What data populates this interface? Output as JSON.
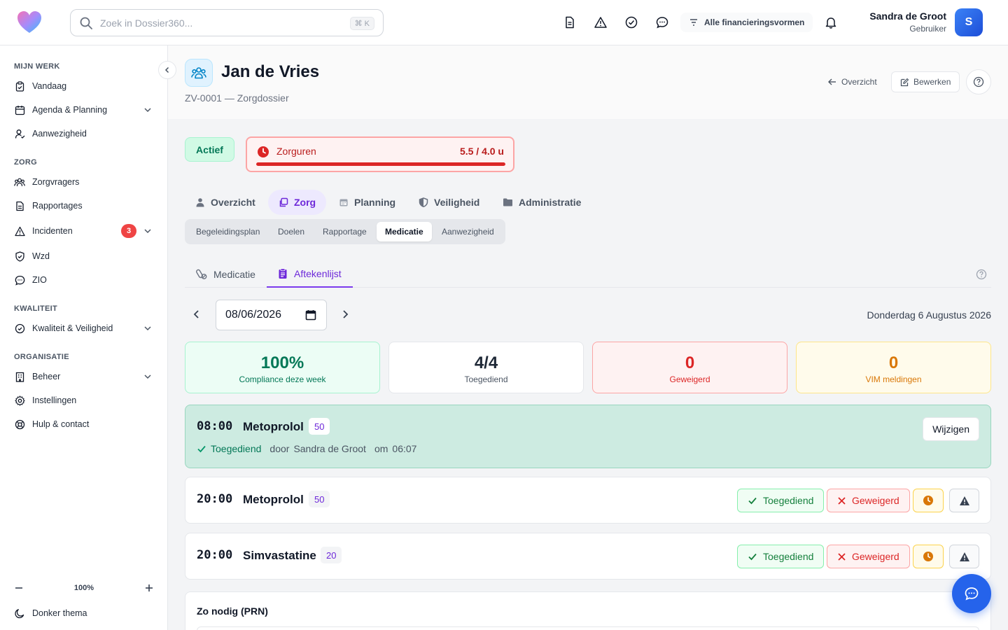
{
  "topbar": {
    "search_placeholder": "Zoek in Dossier360...",
    "search_shortcut": "⌘ K",
    "financing_filter": "Alle financieringsvormen",
    "user_name": "Sandra de Groot",
    "user_role": "Gebruiker",
    "avatar_initial": "S"
  },
  "sidebar": {
    "sections": {
      "mijn_werk": "MIJN WERK",
      "zorg": "ZORG",
      "kwaliteit": "KWALITEIT",
      "organisatie": "ORGANISATIE"
    },
    "items": {
      "vandaag": "Vandaag",
      "agenda": "Agenda & Planning",
      "aanwezigheid": "Aanwezigheid",
      "zorgvragers": "Zorgvragers",
      "rapportages": "Rapportages",
      "incidenten": "Incidenten",
      "incidenten_badge": "3",
      "wzd": "Wzd",
      "zio": "ZIO",
      "kwaliteit_veiligheid": "Kwaliteit & Veiligheid",
      "beheer": "Beheer",
      "instellingen": "Instellingen",
      "hulp": "Hulp & contact"
    },
    "zoom_level": "100%",
    "dark_theme": "Donker thema"
  },
  "header": {
    "title": "Jan de Vries",
    "subtitle": "ZV-0001 — Zorgdossier",
    "overview_link": "Overzicht",
    "edit_button": "Bewerken"
  },
  "status": {
    "label": "Actief",
    "zorguren_label": "Zorguren",
    "zorguren_value": "5.5 / 4.0 u",
    "zorguren_fill": 1.0
  },
  "main_tabs": [
    "Overzicht",
    "Zorg",
    "Planning",
    "Veiligheid",
    "Administratie"
  ],
  "sub_tabs": [
    "Begeleidingsplan",
    "Doelen",
    "Rapportage",
    "Medicatie",
    "Aanwezigheid"
  ],
  "inner_tabs": [
    "Medicatie",
    "Aftekenlijst"
  ],
  "date_picker": {
    "value": "08/06/2026",
    "long_label": "Donderdag 6 Augustus 2026"
  },
  "stats": [
    {
      "value": "100%",
      "caption": "Compliance deze week"
    },
    {
      "value": "4/4",
      "caption": "Toegediend"
    },
    {
      "value": "0",
      "caption": "Geweigerd"
    },
    {
      "value": "0",
      "caption": "VIM meldingen"
    }
  ],
  "medications": [
    {
      "time": "08:00",
      "name": "Metoprolol",
      "dose": "50",
      "status": "Toegediend",
      "by_prefix": "door",
      "by_name": "Sandra de Groot",
      "at_prefix": "om",
      "at_time": "06:07",
      "change_button": "Wijzigen"
    },
    {
      "time": "20:00",
      "name": "Metoprolol",
      "dose": "50"
    },
    {
      "time": "20:00",
      "name": "Simvastatine",
      "dose": "20"
    }
  ],
  "action_labels": {
    "administered": "Toegediend",
    "refused": "Geweigerd"
  },
  "prn_title": "Zo nodig (PRN)"
}
